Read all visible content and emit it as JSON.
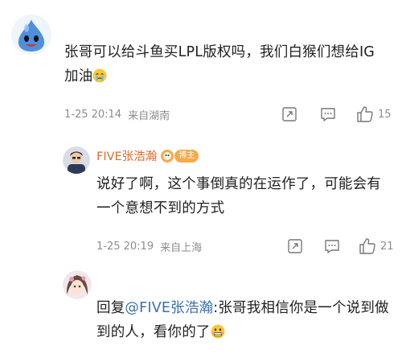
{
  "comments": [
    {
      "username": "",
      "text": "张哥可以给斗鱼买LPL版权吗，我们白猴们想给IG加油",
      "time": "1-25 20:14",
      "location": "来自湖南",
      "likes": "15",
      "emoji": "crying-face-emoji"
    },
    {
      "username": "FIVE张浩瀚",
      "badge": "博主",
      "text": "说好了啊，这个事倒真的在运作了，可能会有一个意想不到的方式",
      "time": "1-25 20:19",
      "location": "来自上海",
      "likes": "21"
    },
    {
      "username": "",
      "reply_prefix": "回复",
      "mention": "@FIVE张浩瀚",
      "text": ":张哥我相信你是一个说到做到的人，看你的了",
      "emoji": "grimacing-face-emoji"
    }
  ],
  "colors": {
    "accent_name": "#e56a2b",
    "mention": "#3a6fb4",
    "meta": "#8d8d8d",
    "badge": "#f7a94a"
  },
  "icons": [
    "share-icon",
    "comment-icon",
    "like-icon"
  ]
}
